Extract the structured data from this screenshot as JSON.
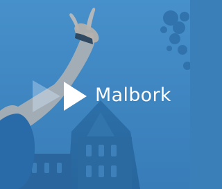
{
  "video_tile": {
    "title": "Malbork",
    "play_icon": "play-icon",
    "colors": {
      "tint": "#3f88c4",
      "text": "#ffffff"
    }
  }
}
